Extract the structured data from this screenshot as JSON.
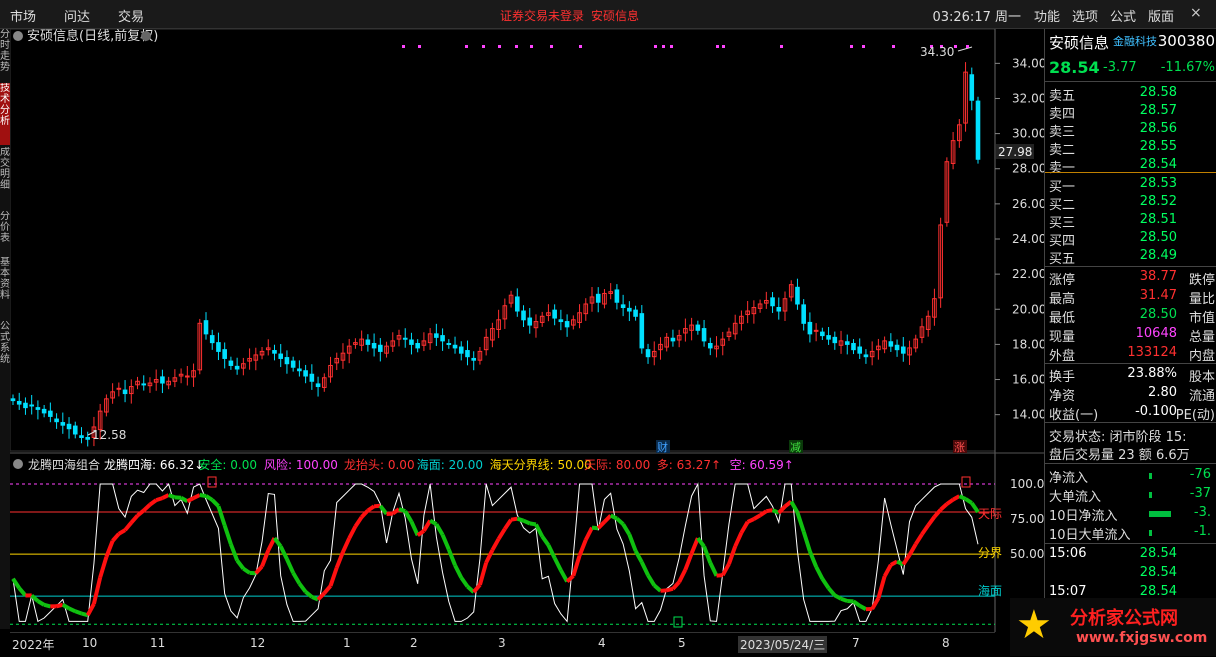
{
  "topbar": {
    "menu": [
      "市场",
      "问达",
      "交易"
    ],
    "notice_login": "证券交易未登录",
    "notice_stock": "安硕信息",
    "clock": "03:26:17 周一",
    "right_menu": [
      "功能",
      "选项",
      "公式",
      "版面"
    ],
    "win_min": "–",
    "win_close": "×"
  },
  "left_tabs": [
    {
      "label": "分时走势",
      "active": false
    },
    {
      "label": "技术分析",
      "active": true
    },
    {
      "label": "成交明细",
      "active": false
    },
    {
      "label": "分价表",
      "active": false
    },
    {
      "label": "基本资料",
      "active": false
    },
    {
      "label": "公式系统",
      "active": false
    }
  ],
  "chart_header": {
    "title": "安硕信息(日线,前复权)",
    "high_label": "34.30",
    "low_label": "12.58",
    "current_price_tag": "27.98"
  },
  "indicator_header": {
    "name": "龙腾四海组合",
    "items": [
      {
        "label": "龙腾四海: 66.32↓",
        "color": "#ffffff"
      },
      {
        "label": "安全: 0.00",
        "color": "#00e050"
      },
      {
        "label": "风险: 100.00",
        "color": "#ff44ff"
      },
      {
        "label": "龙抬头: 0.00",
        "color": "#ff3030"
      },
      {
        "label": "海面: 20.00",
        "color": "#00cccc"
      },
      {
        "label": "海天分界线: 50.00",
        "color": "#ffd700"
      },
      {
        "label": "天际: 80.00",
        "color": "#ff3030"
      },
      {
        "label": "多: 63.27↑",
        "color": "#ff3030"
      },
      {
        "label": "空: 60.59↑",
        "color": "#ff44ff"
      }
    ]
  },
  "markers": {
    "cai": "财",
    "jian": "减",
    "zhang": "涨"
  },
  "indicator_side_labels": {
    "tianji": "天际",
    "fenjie": "分界",
    "haimian": "海面"
  },
  "x_axis": {
    "labels": [
      "2022年",
      "10",
      "11",
      "12",
      "1",
      "2",
      "3",
      "4",
      "5",
      "2023/05/24/三",
      "7",
      "8"
    ]
  },
  "colors": {
    "up": "#ff3030",
    "down": "#00e0ff",
    "ma_up": "#ff1010",
    "ma_down": "#10c010",
    "line_white": "#ffffff"
  },
  "quote": {
    "name": "安硕信息",
    "sector": "金融科技",
    "code": "300380",
    "price": "28.54",
    "change": "-3.77",
    "change_pct": "-11.67%",
    "asks": [
      {
        "label": "卖五",
        "price": "28.58"
      },
      {
        "label": "卖四",
        "price": "28.57"
      },
      {
        "label": "卖三",
        "price": "28.56"
      },
      {
        "label": "卖二",
        "price": "28.55"
      },
      {
        "label": "卖一",
        "price": "28.54"
      }
    ],
    "bids": [
      {
        "label": "买一",
        "price": "28.53"
      },
      {
        "label": "买二",
        "price": "28.52"
      },
      {
        "label": "买三",
        "price": "28.51"
      },
      {
        "label": "买四",
        "price": "28.50"
      },
      {
        "label": "买五",
        "price": "28.49"
      }
    ],
    "stats": [
      {
        "l": "涨停",
        "v": "38.77",
        "r": "跌停",
        "vc": "red"
      },
      {
        "l": "最高",
        "v": "31.47",
        "r": "量比",
        "vc": "red"
      },
      {
        "l": "最低",
        "v": "28.50",
        "r": "市值",
        "vc": "green"
      },
      {
        "l": "现量",
        "v": "10648",
        "r": "总量",
        "vc": "mag"
      },
      {
        "l": "外盘",
        "v": "133124",
        "r": "内盘",
        "vc": "red"
      }
    ],
    "stats2": [
      {
        "l": "换手",
        "v": "23.88%",
        "r": "股本"
      },
      {
        "l": "净资",
        "v": "2.80",
        "r": "流通"
      },
      {
        "l": "收益(一)",
        "v": "-0.100",
        "r": "PE(动)"
      }
    ],
    "trade_status": "交易状态: 闭市阶段 15:",
    "after_hours": "盘后交易量 23 额 6.6万",
    "flows": [
      {
        "l": "净流入",
        "v": "-76"
      },
      {
        "l": "大单流入",
        "v": "-37"
      },
      {
        "l": "10日净流入",
        "v": "-3."
      },
      {
        "l": "10日大单流入",
        "v": "-1."
      }
    ],
    "ticks": [
      {
        "t": "15:06",
        "p": "28.54"
      },
      {
        "t": "",
        "p": "28.54"
      },
      {
        "t": "15:07",
        "p": "28.54"
      }
    ]
  },
  "logo": {
    "line1": "分析家公式网",
    "line2": "www.fxjgsw.com"
  },
  "chart_data": {
    "type": "candlestick",
    "price_axis": {
      "ticks": [
        "34.00",
        "32.00",
        "30.00",
        "28.00",
        "26.00",
        "24.00",
        "22.00",
        "20.00",
        "18.00",
        "16.00",
        "14.00"
      ],
      "ylim": [
        12.5,
        35.5
      ]
    },
    "indicator_axis": {
      "ticks": [
        "100.0",
        "75.00",
        "50.00"
      ],
      "ylim": [
        -2,
        105
      ]
    },
    "closes": [
      14.8,
      14.6,
      14.4,
      14.5,
      14.3,
      14.1,
      13.9,
      13.6,
      13.4,
      13.2,
      12.9,
      12.7,
      12.6,
      13.3,
      14.2,
      14.9,
      15.3,
      15.5,
      15.2,
      15.6,
      15.9,
      15.7,
      15.8,
      16.0,
      15.8,
      15.9,
      16.1,
      16.3,
      16.2,
      16.5,
      19.2,
      18.6,
      18.1,
      17.6,
      17.2,
      16.8,
      16.6,
      16.9,
      17.2,
      17.4,
      17.6,
      17.8,
      17.5,
      17.2,
      16.9,
      16.7,
      16.5,
      16.2,
      15.9,
      15.6,
      16.1,
      16.8,
      17.2,
      17.5,
      17.9,
      18.1,
      18.3,
      18.0,
      17.8,
      17.6,
      17.9,
      18.2,
      18.5,
      18.3,
      18.0,
      17.8,
      18.2,
      18.6,
      18.4,
      18.2,
      18.0,
      17.8,
      17.5,
      17.3,
      17.1,
      17.6,
      18.4,
      18.9,
      19.4,
      20.2,
      20.8,
      19.9,
      19.4,
      19.1,
      19.3,
      19.6,
      19.8,
      19.5,
      19.3,
      19.0,
      19.4,
      19.8,
      20.3,
      20.7,
      20.4,
      20.9,
      21.0,
      20.4,
      20.1,
      19.9,
      19.6,
      17.8,
      17.3,
      17.6,
      18.0,
      18.4,
      18.2,
      18.5,
      18.9,
      19.1,
      18.8,
      18.2,
      17.8,
      17.9,
      18.3,
      18.7,
      19.2,
      19.6,
      19.9,
      20.1,
      20.3,
      20.5,
      20.2,
      19.9,
      20.6,
      21.4,
      20.3,
      19.2,
      18.6,
      18.8,
      18.5,
      18.3,
      18.1,
      18.2,
      18.0,
      17.7,
      17.5,
      17.3,
      17.6,
      17.9,
      18.2,
      17.9,
      17.7,
      17.5,
      17.8,
      18.3,
      19.0,
      19.6,
      20.6,
      24.8,
      28.4,
      29.6,
      30.5,
      33.5,
      31.9,
      28.54
    ]
  }
}
